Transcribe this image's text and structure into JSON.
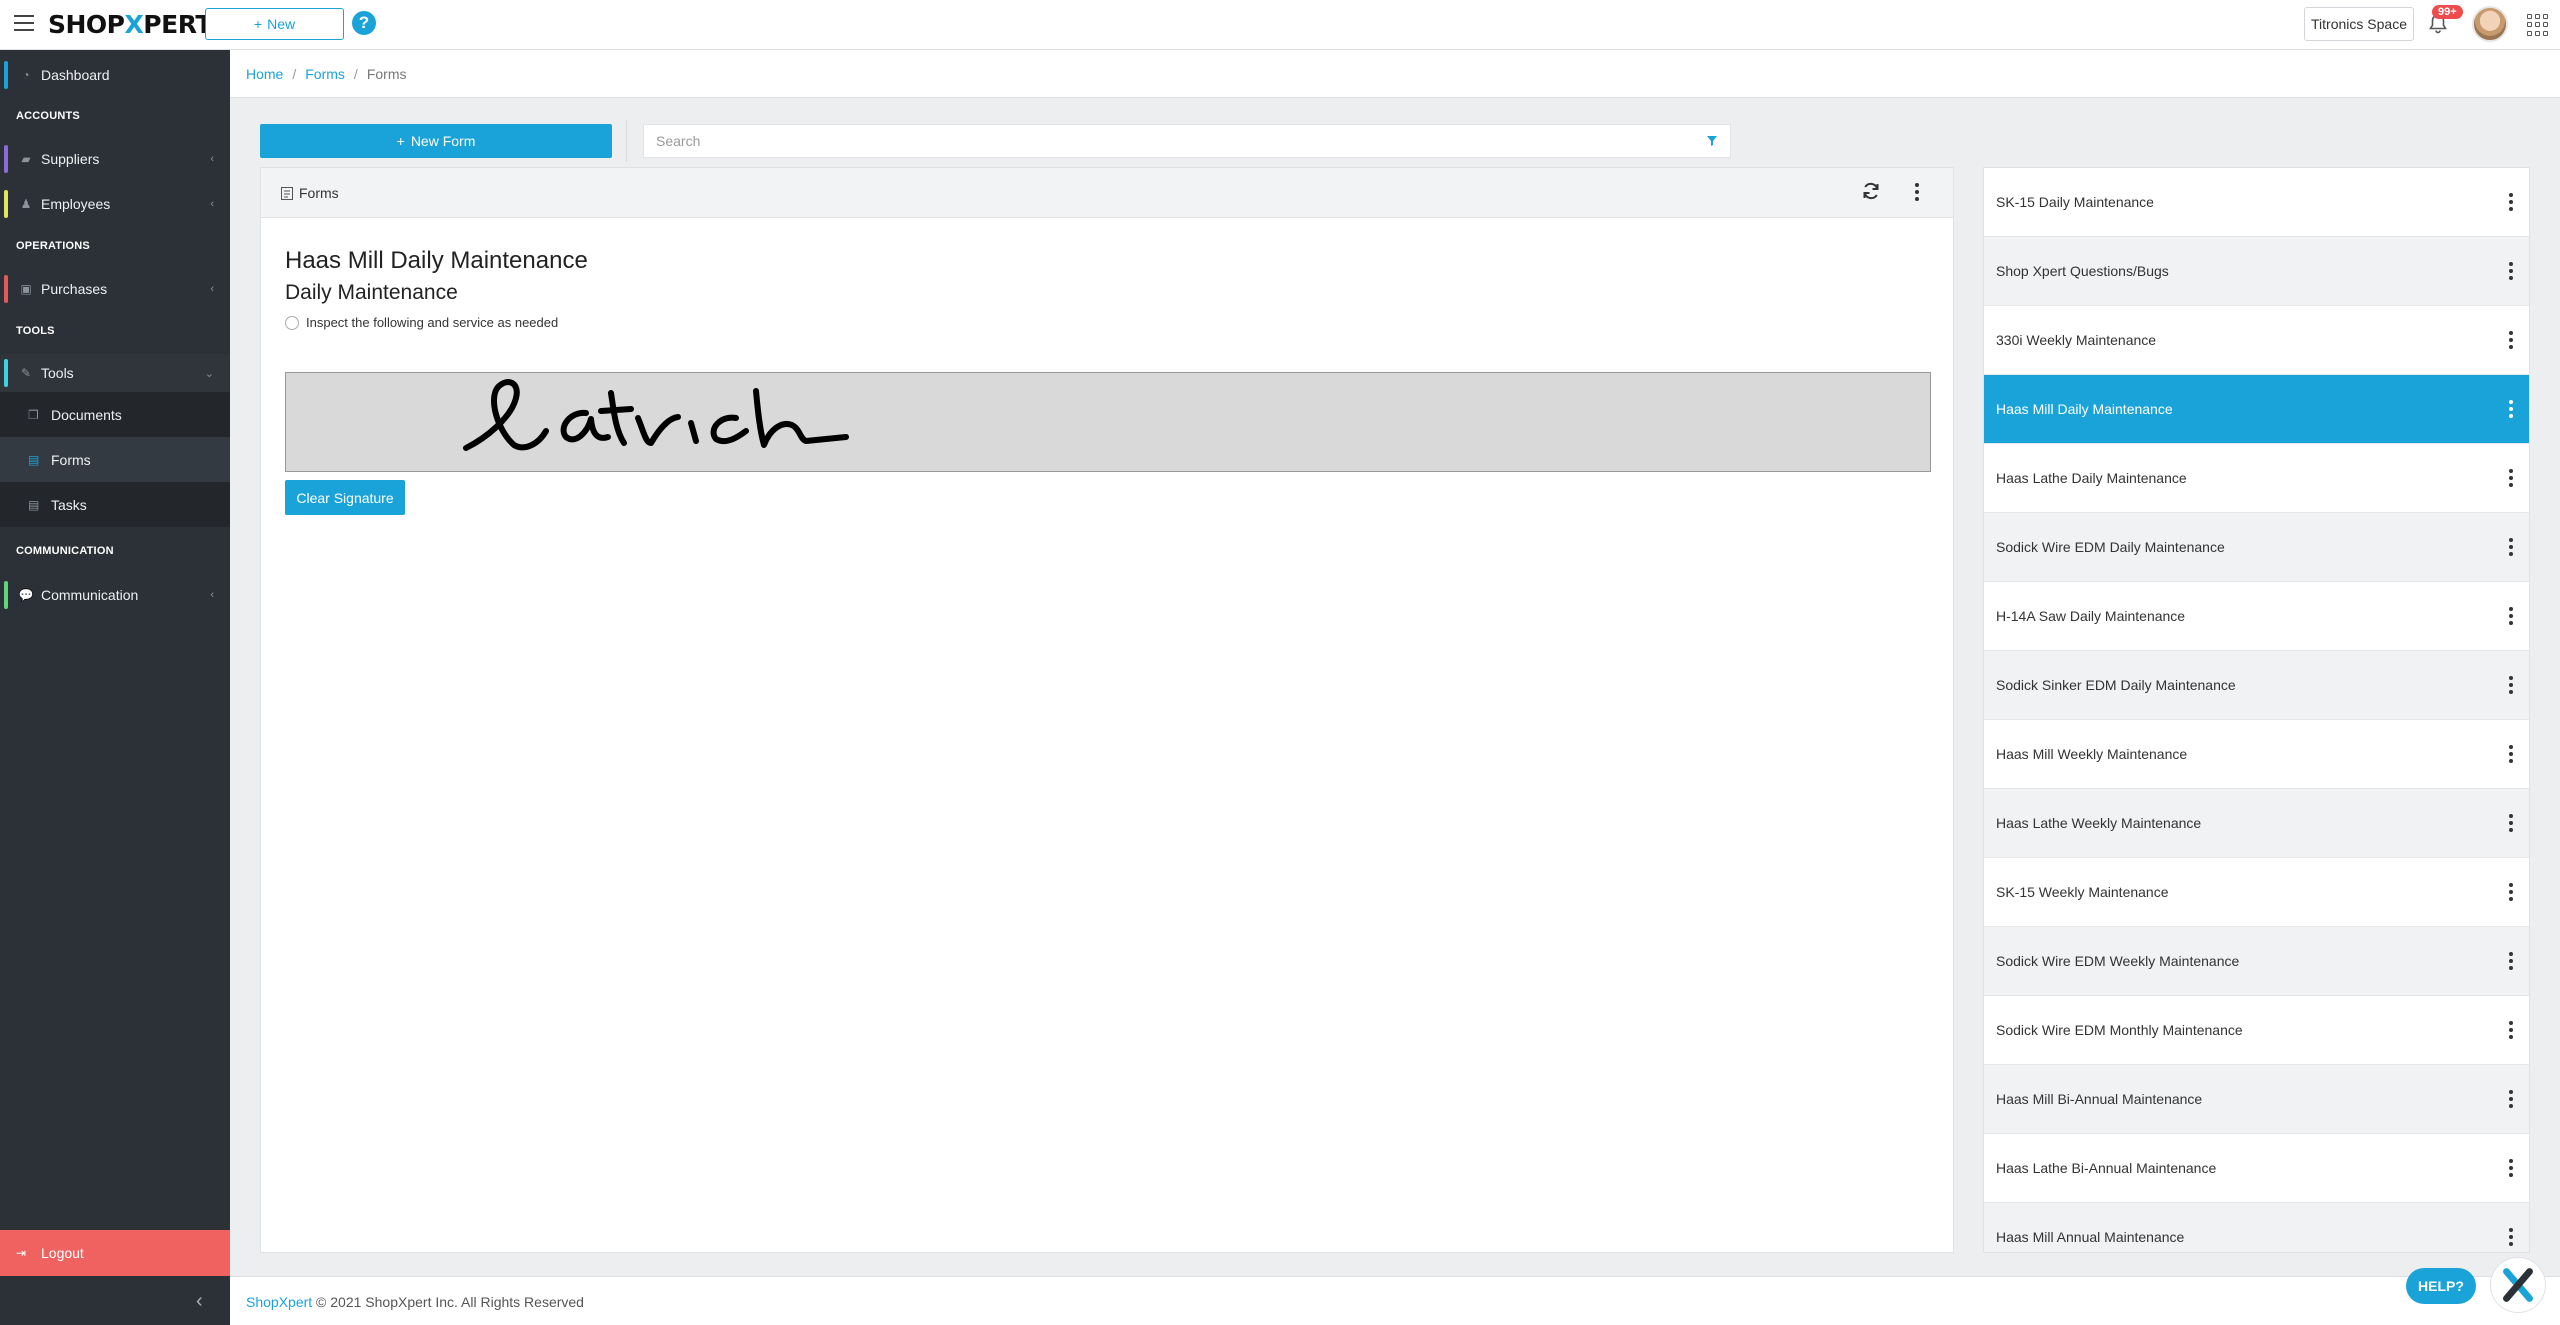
{
  "header": {
    "logo_left": "SHOP",
    "logo_x": "X",
    "logo_right": "PERT",
    "new_label": "New",
    "help_glyph": "?",
    "space_label": "Titronics Space",
    "notification_count": "99+"
  },
  "sidebar": {
    "dashboard": "Dashboard",
    "sections": {
      "accounts": "ACCOUNTS",
      "operations": "OPERATIONS",
      "tools": "TOOLS",
      "communication": "COMMUNICATION"
    },
    "items": {
      "suppliers": "Suppliers",
      "employees": "Employees",
      "purchases": "Purchases",
      "tools": "Tools",
      "documents": "Documents",
      "forms": "Forms",
      "tasks": "Tasks",
      "communication": "Communication"
    },
    "logout": "Logout",
    "accent_colors": {
      "dashboard": "#1aa3d9",
      "suppliers": "#8e6bd8",
      "employees": "#e3e65b",
      "purchases": "#e25b5b",
      "tools": "#3fd2e3",
      "communication": "#5ed77a"
    }
  },
  "breadcrumb": {
    "home": "Home",
    "forms": "Forms",
    "current": "Forms"
  },
  "actions": {
    "new_form": "New Form",
    "search_placeholder": "Search",
    "search_value": ""
  },
  "panel": {
    "title": "Forms",
    "form_title": "Haas Mill Daily Maintenance",
    "section_title": "Daily Maintenance",
    "radio_label": "Inspect the following and service as needed",
    "clear_signature": "Clear Signature"
  },
  "form_list": [
    {
      "label": "SK-15 Daily Maintenance"
    },
    {
      "label": "Shop Xpert Questions/Bugs"
    },
    {
      "label": "330i Weekly Maintenance"
    },
    {
      "label": "Haas Mill Daily Maintenance",
      "selected": true
    },
    {
      "label": "Haas Lathe Daily Maintenance"
    },
    {
      "label": "Sodick Wire EDM Daily Maintenance"
    },
    {
      "label": "H-14A Saw Daily Maintenance"
    },
    {
      "label": "Sodick Sinker EDM Daily Maintenance"
    },
    {
      "label": "Haas Mill Weekly Maintenance"
    },
    {
      "label": "Haas Lathe Weekly Maintenance"
    },
    {
      "label": "SK-15 Weekly Maintenance"
    },
    {
      "label": "Sodick Wire EDM Weekly Maintenance"
    },
    {
      "label": "Sodick Wire EDM Monthly Maintenance"
    },
    {
      "label": "Haas Mill Bi-Annual Maintenance"
    },
    {
      "label": "Haas Lathe Bi-Annual Maintenance"
    },
    {
      "label": "Haas Mill Annual Maintenance"
    }
  ],
  "footer": {
    "brand_link": "ShopXpert",
    "copyright": " © 2021 ShopXpert Inc. All Rights Reserved"
  },
  "help_bubble": "HELP?",
  "theme": {
    "accent": "#1aa3d9",
    "sidebar_bg": "#2c3137",
    "logout_bg": "#f0625f"
  }
}
